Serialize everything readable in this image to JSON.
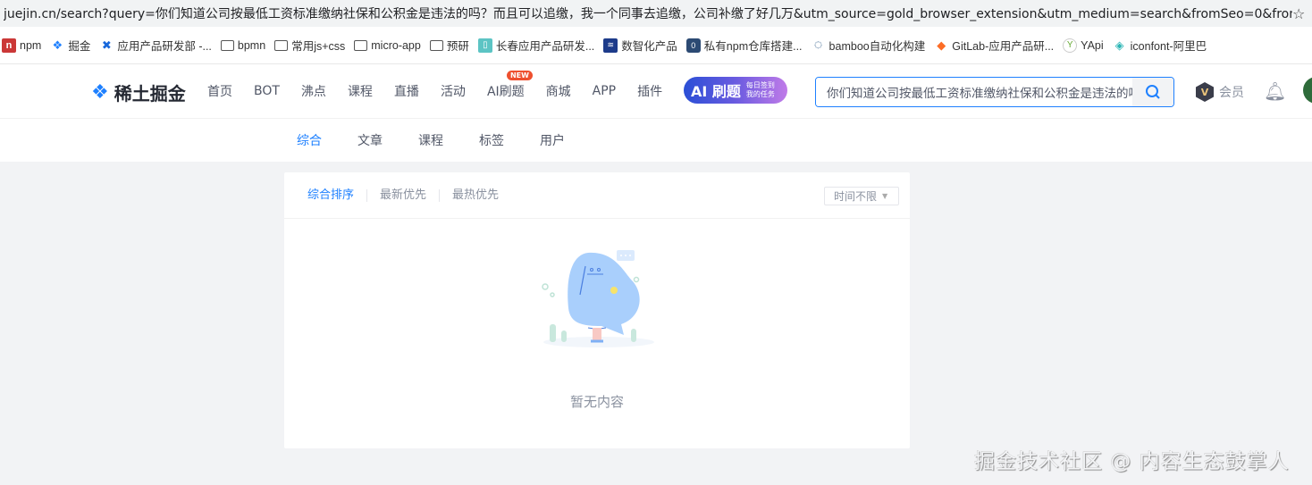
{
  "browser": {
    "url": "juejin.cn/search?query=你们知道公司按最低工资标准缴纳社保和公积金是违法的吗？而且可以追缴，我一个同事去追缴，公司补缴了好几万&utm_source=gold_browser_extension&utm_medium=search&fromSeo=0&from...",
    "bookmarks": [
      {
        "label": "npm",
        "icon": "npm-icon"
      },
      {
        "label": "掘金",
        "icon": "juejin-icon"
      },
      {
        "label": "应用产品研发部 -...",
        "icon": "confluence-icon"
      },
      {
        "label": "bpmn",
        "icon": "folder-icon"
      },
      {
        "label": "常用js+css",
        "icon": "folder-icon"
      },
      {
        "label": "micro-app",
        "icon": "folder-icon"
      },
      {
        "label": "预研",
        "icon": "folder-icon"
      },
      {
        "label": "长春应用产品研发...",
        "icon": "app-icon"
      },
      {
        "label": "数智化产品",
        "icon": "product-icon"
      },
      {
        "label": "私有npm仓库搭建...",
        "icon": "bucket-icon"
      },
      {
        "label": "bamboo自动化构建",
        "icon": "bamboo-icon"
      },
      {
        "label": "GitLab-应用产品研...",
        "icon": "gitlab-icon"
      },
      {
        "label": "YApi",
        "icon": "yapi-icon"
      },
      {
        "label": "iconfont-阿里巴",
        "icon": "iconfont-icon"
      }
    ]
  },
  "header": {
    "logo_text": "稀土掘金",
    "nav": [
      "首页",
      "BOT",
      "沸点",
      "课程",
      "直播",
      "活动",
      "AI刷题",
      "商城",
      "APP",
      "插件"
    ],
    "new_badge": "NEW",
    "ai_banner": {
      "title": "AI 刷题",
      "line1": "每日签到",
      "line2": "我的任务"
    },
    "search_value": "你们知道公司按最低工资标准缴纳社保和公积金是违法的吗",
    "vip_label": "会员"
  },
  "subnav": {
    "tabs": [
      "综合",
      "文章",
      "课程",
      "标签",
      "用户"
    ],
    "active": "综合"
  },
  "results": {
    "sort_tabs": [
      "综合排序",
      "最新优先",
      "最热优先"
    ],
    "time_filter": "时间不限",
    "empty_text": "暂无内容"
  },
  "watermark": "掘金技术社区 @ 内容生态鼓掌人",
  "colors": {
    "accent": "#1e80ff",
    "background": "#f2f3f5",
    "new_badge": "#ee502f"
  }
}
